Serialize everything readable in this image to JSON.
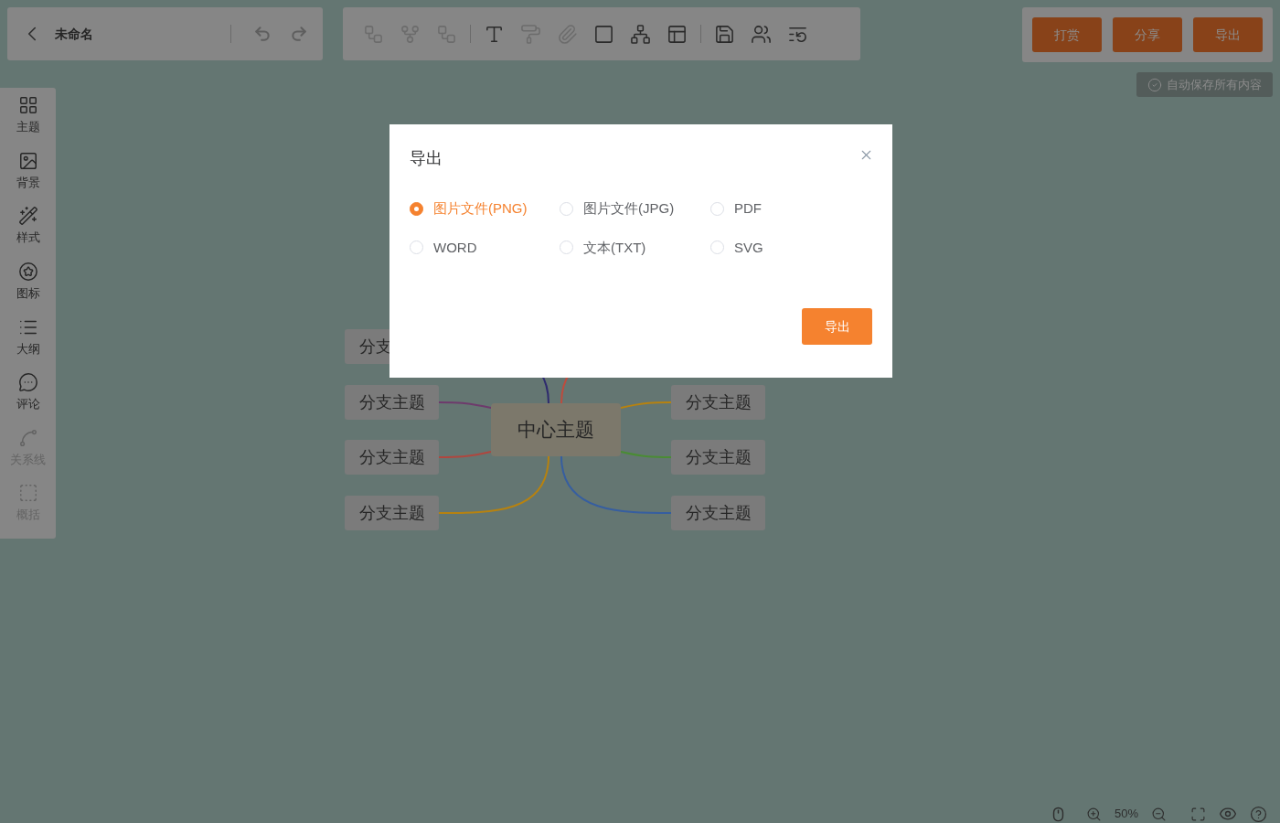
{
  "header": {
    "title": "未命名"
  },
  "toolbar": [
    [
      {
        "kind": "sibling",
        "disabled": true
      },
      {
        "kind": "child",
        "disabled": true
      },
      {
        "kind": "parent",
        "disabled": true
      }
    ],
    [
      {
        "kind": "text",
        "disabled": false
      },
      {
        "kind": "format",
        "disabled": true
      },
      {
        "kind": "attach",
        "disabled": true
      },
      {
        "kind": "border",
        "disabled": false
      },
      {
        "kind": "structure",
        "disabled": false
      },
      {
        "kind": "layout",
        "disabled": false
      }
    ],
    [
      {
        "kind": "save",
        "disabled": false
      },
      {
        "kind": "collab",
        "disabled": false
      },
      {
        "kind": "history",
        "disabled": false
      }
    ]
  ],
  "actions": [
    "打赏",
    "分享",
    "导出"
  ],
  "autosave": "自动保存所有内容",
  "sidebar": {
    "items": [
      {
        "kind": "theme",
        "label": "主题",
        "disabled": false
      },
      {
        "kind": "background",
        "label": "背景",
        "disabled": false
      },
      {
        "kind": "style",
        "label": "样式",
        "disabled": false
      },
      {
        "kind": "icon",
        "label": "图标",
        "disabled": false
      },
      {
        "kind": "outline",
        "label": "大纲",
        "disabled": false
      },
      {
        "kind": "comment",
        "label": "评论",
        "disabled": false
      },
      {
        "kind": "relation",
        "label": "关系线",
        "disabled": true
      },
      {
        "kind": "summary",
        "label": "概括",
        "disabled": true
      }
    ]
  },
  "mindmap": {
    "center": "中心主题",
    "branches": [
      {
        "kind": "left",
        "text": "分支",
        "color": "#2e2a6e"
      },
      {
        "kind": "left",
        "text": "分支主题",
        "color": "#6e3a6c"
      },
      {
        "kind": "left",
        "text": "分支主题",
        "color": "#b0463e"
      },
      {
        "kind": "left",
        "text": "分支主题",
        "color": "#b7820f"
      },
      {
        "kind": "right",
        "color": "#bd4c3e"
      },
      {
        "kind": "right",
        "text": "分支主题",
        "color": "#b7820f"
      },
      {
        "kind": "right",
        "text": "分支主题",
        "color": "#4a8c34"
      },
      {
        "kind": "right",
        "text": "分支主题",
        "color": "#365ea0"
      }
    ]
  },
  "zoom": {
    "value": "50%"
  },
  "dialog": {
    "title": "导出",
    "options": [
      {
        "label": "图片文件(PNG)",
        "selected": true
      },
      {
        "label": "图片文件(JPG)",
        "selected": false
      },
      {
        "label": "PDF",
        "selected": false
      },
      {
        "label": "WORD",
        "selected": false
      },
      {
        "label": "文本(TXT)",
        "selected": false
      },
      {
        "label": "SVG",
        "selected": false
      }
    ],
    "confirm": "导出"
  }
}
